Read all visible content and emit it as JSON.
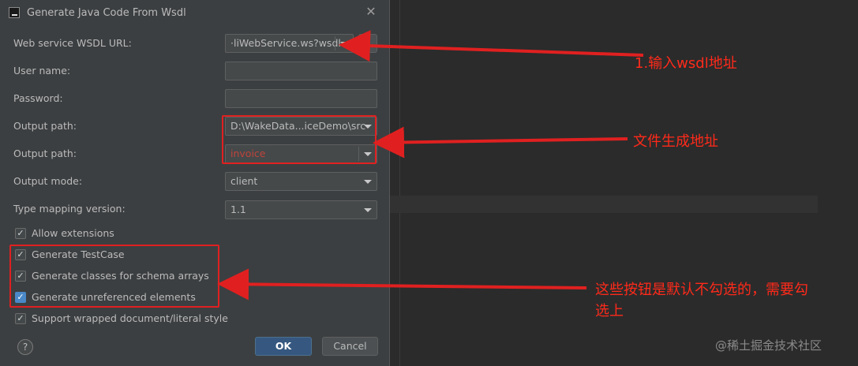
{
  "dialog": {
    "title": "Generate Java Code From Wsdl",
    "fields": {
      "wsdl_url_label": "Web service WSDL URL:",
      "wsdl_url_value": "·liWebService.ws?wsdl",
      "username_label": "User name:",
      "username_value": "",
      "password_label": "Password:",
      "password_value": "",
      "output_path_label": "Output path:",
      "output_path_value": "D:\\WakeData...iceDemo\\src",
      "output_package_label": "Output path:",
      "output_package_value": "invoice",
      "output_mode_label": "Output mode:",
      "output_mode_value": "client",
      "type_mapping_label": "Type mapping version:",
      "type_mapping_value": "1.1"
    },
    "checkboxes": [
      {
        "label": "Allow extensions",
        "checked": true
      },
      {
        "label": "Generate TestCase",
        "checked": true
      },
      {
        "label": "Generate classes for schema arrays",
        "checked": true
      },
      {
        "label": "Generate unreferenced elements",
        "checked": true
      },
      {
        "label": "Support wrapped document/literal style",
        "checked": true
      }
    ],
    "buttons": {
      "help": "?",
      "ok": "OK",
      "cancel": "Cancel"
    }
  },
  "annotations": {
    "url_note": "1.输入wsdl地址",
    "path_note": "文件生成地址",
    "checkbox_note_line1": "这些按钮是默认不勾选的，需要勾",
    "checkbox_note_line2": "选上",
    "watermark": "@稀土掘金技术社区"
  },
  "colors": {
    "annotation_red": "#e02020",
    "dialog_bg": "#3c3f41",
    "ok_button": "#365880"
  }
}
